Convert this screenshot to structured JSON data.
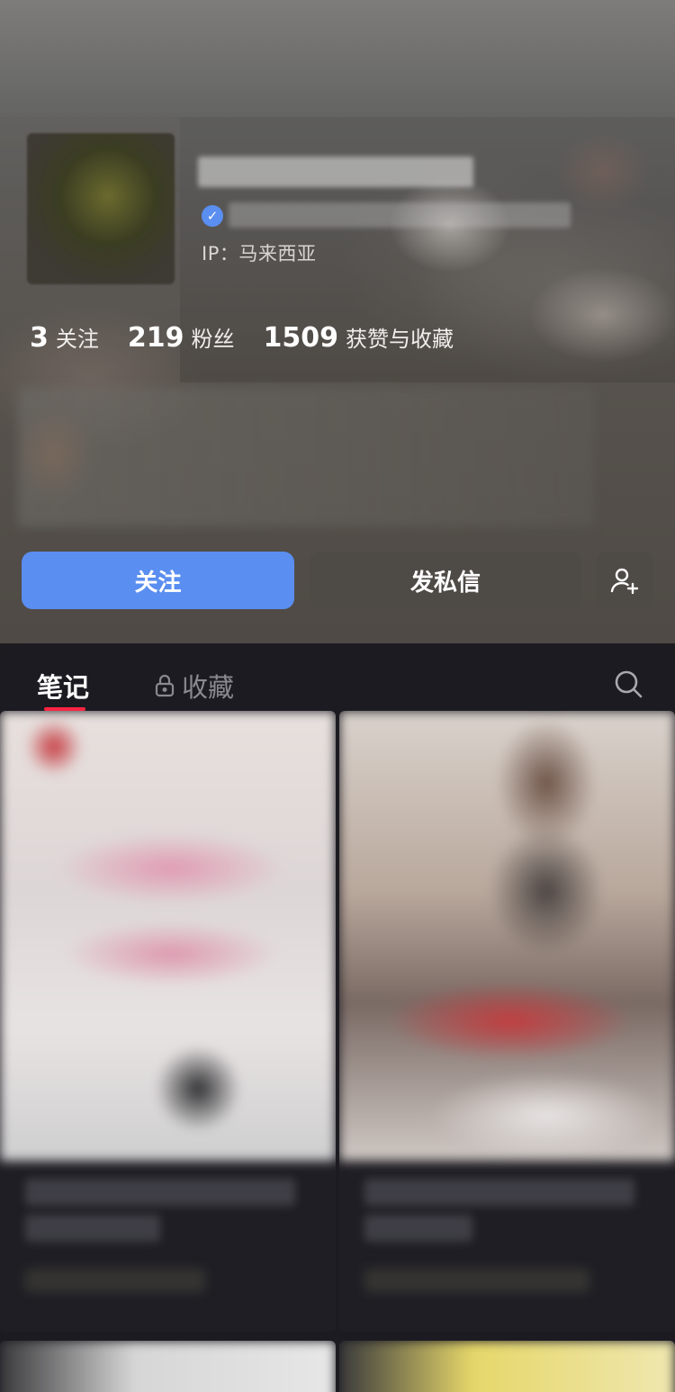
{
  "profile": {
    "ip_label": "IP：马来西亚",
    "stats": [
      {
        "value": "3",
        "label": "关注"
      },
      {
        "value": "219",
        "label": "粉丝"
      },
      {
        "value": "1509",
        "label": "获赞与收藏"
      }
    ]
  },
  "actions": {
    "follow_label": "关注",
    "message_label": "发私信",
    "add_friend_icon": "add-user-icon"
  },
  "tabs": {
    "notes_label": "笔记",
    "favorites_label": "收藏",
    "favorites_icon": "lock-icon",
    "search_icon": "search-icon"
  },
  "colors": {
    "accent": "#5a8ef0",
    "tab_indicator": "#ff2442",
    "secondary_button": "#4e4a46"
  }
}
